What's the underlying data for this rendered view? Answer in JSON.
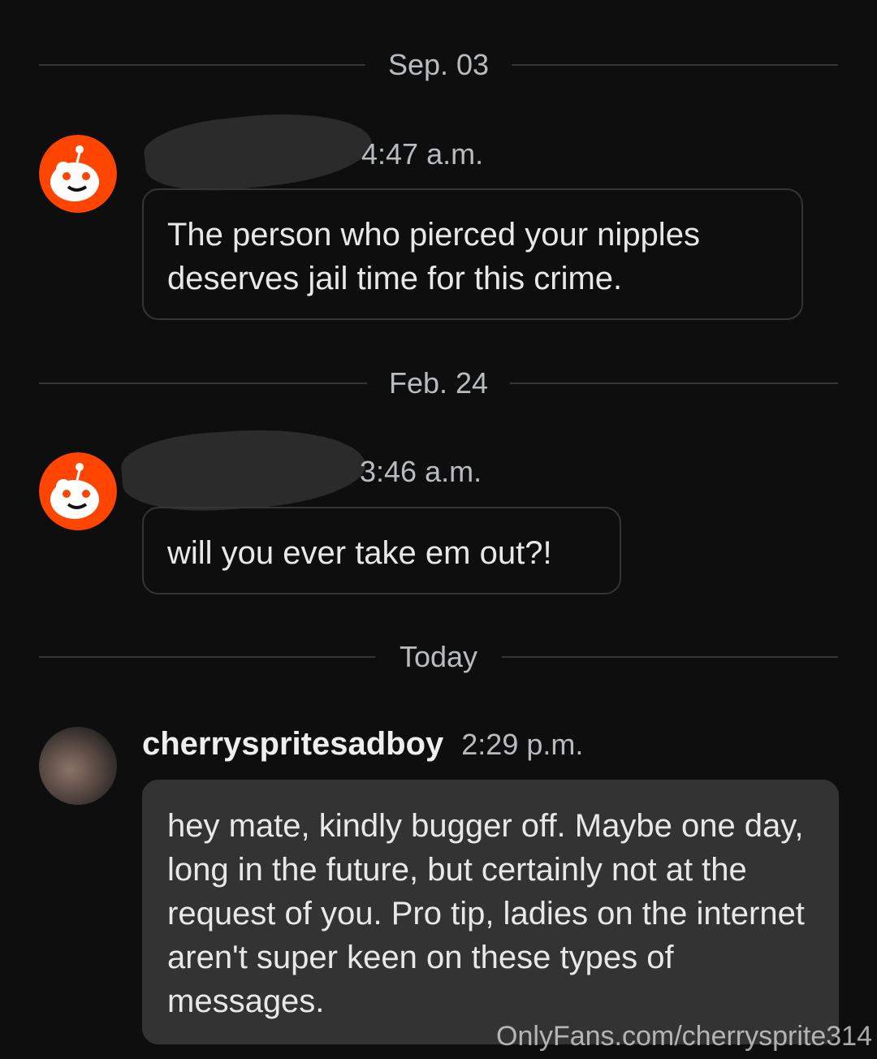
{
  "dates": {
    "first": "Sep. 03",
    "second": "Feb. 24",
    "third": "Today"
  },
  "messages": [
    {
      "username": "",
      "time": "4:47 a.m.",
      "text": "The person who pierced your nipples deserves jail time for this crime."
    },
    {
      "username": "",
      "time": "3:46 a.m.",
      "text": "will you ever take em out?!"
    },
    {
      "username": "cherryspritesadboy",
      "time": "2:29 p.m.",
      "text": "hey mate, kindly bugger off. Maybe one day, long in the future, but certainly not at the request of you. Pro tip, ladies on the internet aren't super keen on these types of messages."
    }
  ],
  "watermark": "OnlyFans.com/cherrysprite314",
  "colors": {
    "background": "#0e0e0f",
    "reddit_orange": "#ff4500",
    "bubble_fill": "#333334",
    "border": "#343536"
  },
  "icons": {
    "default_avatar": "reddit-snoo-avatar-icon"
  }
}
